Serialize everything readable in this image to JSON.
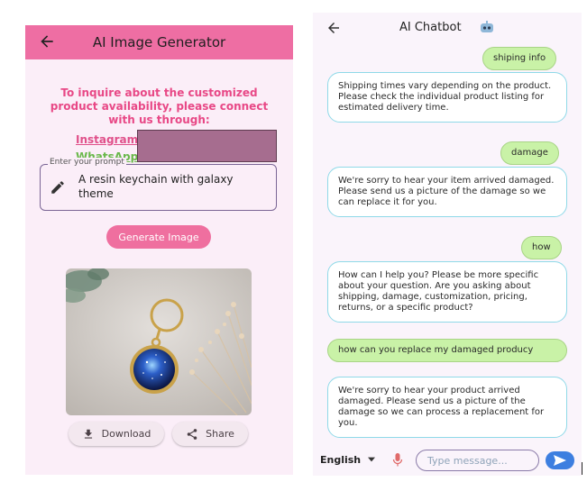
{
  "image_generator": {
    "title": "AI Image Generator",
    "inquiry_text": "To inquire about the customized product availability, please connect with us through:",
    "instagram_label": "Instagram:",
    "whatsapp_label": "WhatsApp",
    "prompt_label": "Enter your prompt",
    "prompt_value": "A resin keychain with galaxy theme",
    "generate_label": "Generate Image",
    "download_label": "Download",
    "share_label": "Share"
  },
  "chatbot": {
    "title": "AI Chatbot",
    "messages": [
      {
        "role": "user",
        "text": "shiping info"
      },
      {
        "role": "bot",
        "text": "Shipping times vary depending on the product.  Please check the individual product listing for estimated delivery time."
      },
      {
        "role": "user",
        "text": "damage"
      },
      {
        "role": "bot",
        "text": "We're sorry to hear your item arrived damaged.  Please send us a picture of the damage so we can replace it for you."
      },
      {
        "role": "user",
        "text": "how"
      },
      {
        "role": "bot",
        "text": "How can I help you?  Please be more specific about your question.  Are you asking about shipping, damage, customization, pricing, returns, or a specific product?"
      },
      {
        "role": "user",
        "text": "how can you replace my damaged producy"
      },
      {
        "role": "bot",
        "text": "We're sorry to hear your product arrived damaged.  Please send us a picture of the damage so we can process a replacement for you."
      }
    ],
    "language": "English",
    "input_placeholder": "Type message..."
  },
  "colors": {
    "appbar_pink": "#ee6ea3",
    "accent_pink": "#e84886",
    "user_bubble": "#c9f2a7",
    "bot_border": "#8fd9e8",
    "send_blue": "#3d7fe0"
  },
  "icons": [
    "arrow-back-icon",
    "pencil-icon",
    "download-icon",
    "share-icon",
    "robot-icon",
    "chevron-down-icon",
    "mic-icon",
    "send-icon"
  ]
}
